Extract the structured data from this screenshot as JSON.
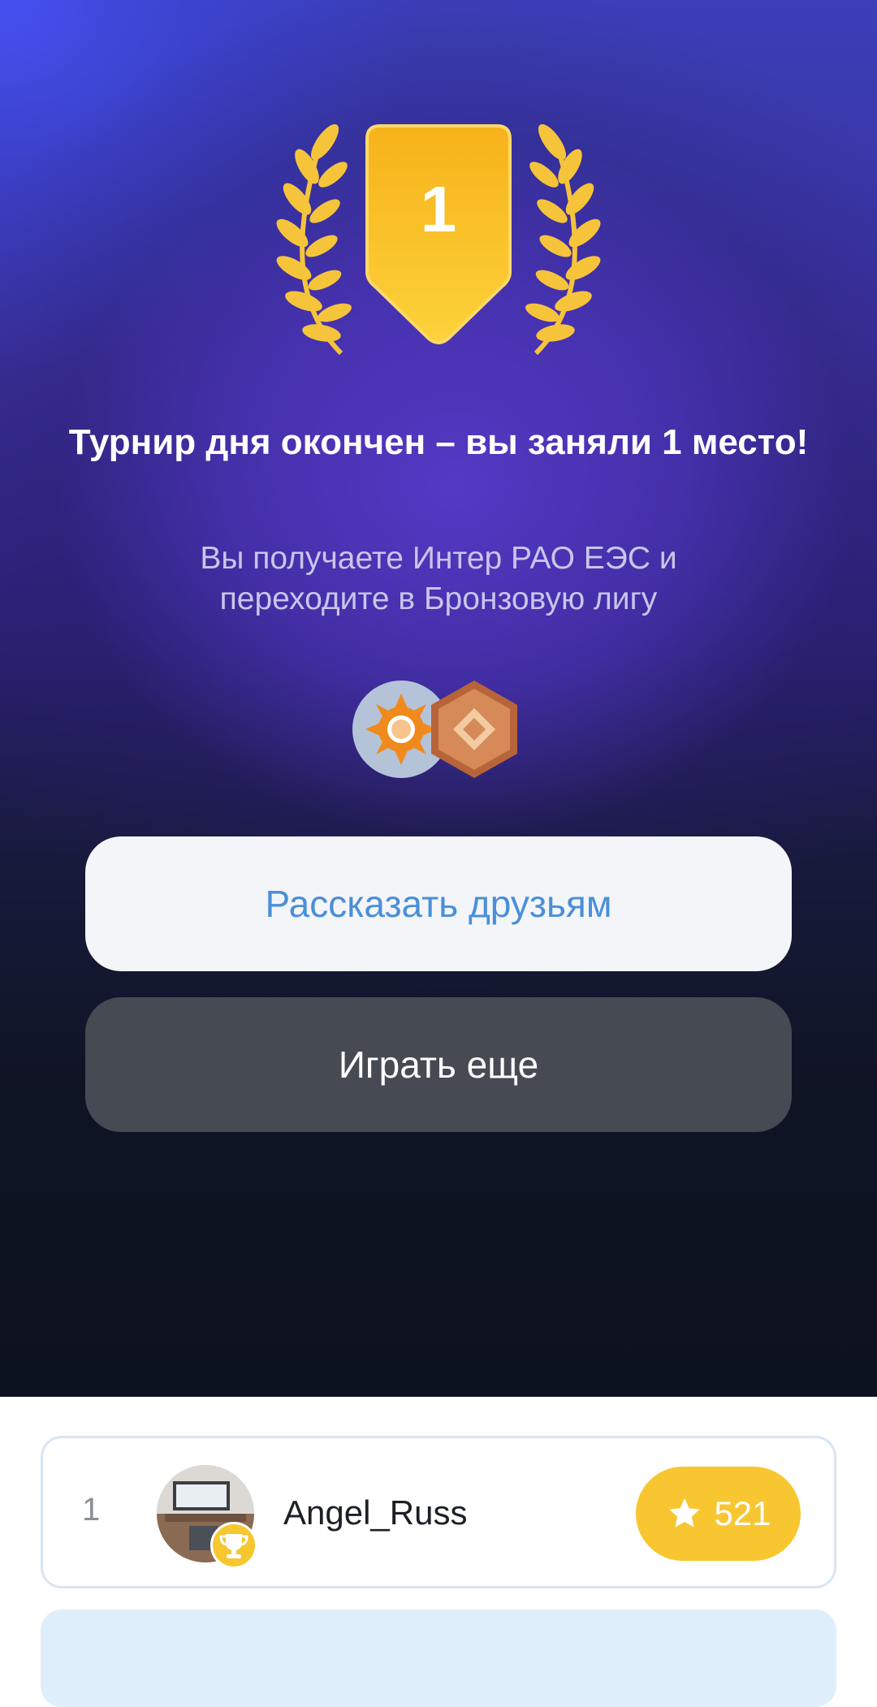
{
  "result": {
    "place": "1",
    "title": "Турнир дня окончен – вы заняли 1 место!",
    "subtitle": "Вы получаете Интер РАО ЕЭС и переходите в Бронзовую лигу"
  },
  "badges": [
    "inter-rao-logo-icon",
    "bronze-league-icon"
  ],
  "buttons": {
    "share": "Рассказать друзьям",
    "play_again": "Играть еще"
  },
  "leaderboard": [
    {
      "rank": "1",
      "username": "Angel_Russ",
      "score": "521",
      "icon": "star-icon"
    }
  ],
  "colors": {
    "accent_gold": "#f8c630",
    "share_text": "#4a8fd8",
    "card_border": "#d7e6f3"
  }
}
